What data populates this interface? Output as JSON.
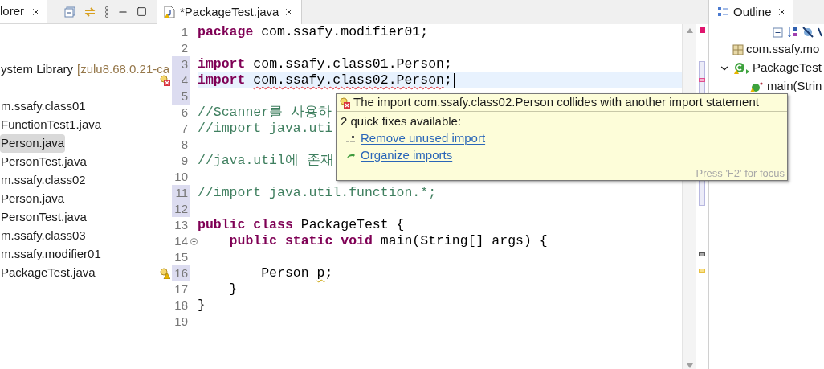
{
  "explorer": {
    "tab": "lorer",
    "items": [
      {
        "label": "ystem Library",
        "suffix": "[zulu8.68.0.21-ca",
        "selected": false
      },
      {
        "label": "m.ssafy.class01",
        "selected": false,
        "children": [
          {
            "label": "FunctionTest1.java",
            "selected": false
          },
          {
            "label": "Person.java",
            "selected": true
          },
          {
            "label": "PersonTest.java",
            "selected": false
          }
        ]
      },
      {
        "label": "m.ssafy.class02",
        "selected": false,
        "children": [
          {
            "label": "Person.java",
            "selected": false
          },
          {
            "label": "PersonTest.java",
            "selected": false
          }
        ]
      },
      {
        "label": "m.ssafy.class03",
        "selected": false
      },
      {
        "label": "m.ssafy.modifier01",
        "selected": false,
        "children": [
          {
            "label": "PackageTest.java",
            "selected": false
          }
        ]
      }
    ]
  },
  "editor": {
    "tab": "*PackageTest.java",
    "lines": [
      {
        "no": "1",
        "segments": [
          {
            "kind": "keyword",
            "text": "package"
          },
          {
            "kind": "plain",
            "text": " com.ssafy.modifier01;"
          }
        ]
      },
      {
        "no": "2"
      },
      {
        "no": "3",
        "range": true,
        "segments": [
          {
            "kind": "keyword",
            "text": "import"
          },
          {
            "kind": "plain",
            "text": " com.ssafy.class01.Person;"
          }
        ]
      },
      {
        "no": "4",
        "range": true,
        "current": true,
        "error": true,
        "segments": [
          {
            "kind": "keyword",
            "text": "import "
          },
          {
            "kind": "plain",
            "text": "com.ssafy.class02.Person",
            "error": true
          },
          {
            "kind": "plain",
            "text": ";"
          }
        ]
      },
      {
        "no": "5",
        "range": true
      },
      {
        "no": "6",
        "segments": [
          {
            "kind": "comment",
            "text": "//Scanner를 사용하"
          }
        ]
      },
      {
        "no": "7",
        "segments": [
          {
            "kind": "comment",
            "text": "//import java.uti"
          }
        ]
      },
      {
        "no": "8"
      },
      {
        "no": "9",
        "segments": [
          {
            "kind": "comment",
            "text": "//java.util에 존재"
          }
        ]
      },
      {
        "no": "10"
      },
      {
        "no": "11",
        "range": true,
        "segments": [
          {
            "kind": "comment",
            "text": "//import java.util.function.*;"
          }
        ]
      },
      {
        "no": "12",
        "range": true
      },
      {
        "no": "13",
        "segments": [
          {
            "kind": "keyword",
            "text": "public class"
          },
          {
            "kind": "plain",
            "text": " PackageTest {"
          }
        ]
      },
      {
        "no": "14",
        "fold": true,
        "segments": [
          {
            "kind": "keyword",
            "text": "    public static void"
          },
          {
            "kind": "plain",
            "text": " main(String[] args) {"
          }
        ]
      },
      {
        "no": "15"
      },
      {
        "no": "16",
        "range": true,
        "warning": true,
        "segments": [
          {
            "kind": "plain",
            "text": "        Person "
          },
          {
            "kind": "plain",
            "text": "p",
            "warning": true
          },
          {
            "kind": "plain",
            "text": ";"
          }
        ]
      },
      {
        "no": "17",
        "segments": [
          {
            "kind": "plain",
            "text": "    }"
          }
        ]
      },
      {
        "no": "18",
        "segments": [
          {
            "kind": "plain",
            "text": "}"
          }
        ]
      },
      {
        "no": "19"
      }
    ]
  },
  "hover": {
    "title": "The import com.ssafy.class02.Person collides with another import statement",
    "subtitle": "2 quick fixes available:",
    "fixes": [
      {
        "kind": "remove",
        "label": "Remove unused import"
      },
      {
        "kind": "organize",
        "label": "Organize imports"
      }
    ],
    "footer": "Press 'F2' for focus"
  },
  "outline": {
    "tab": "Outline",
    "items": [
      {
        "label": "com.ssafy.mo",
        "kind": "package"
      },
      {
        "label": "PackageTest",
        "kind": "class",
        "expanded": true,
        "children": [
          {
            "label": "main(Strin",
            "kind": "method"
          }
        ]
      }
    ]
  }
}
